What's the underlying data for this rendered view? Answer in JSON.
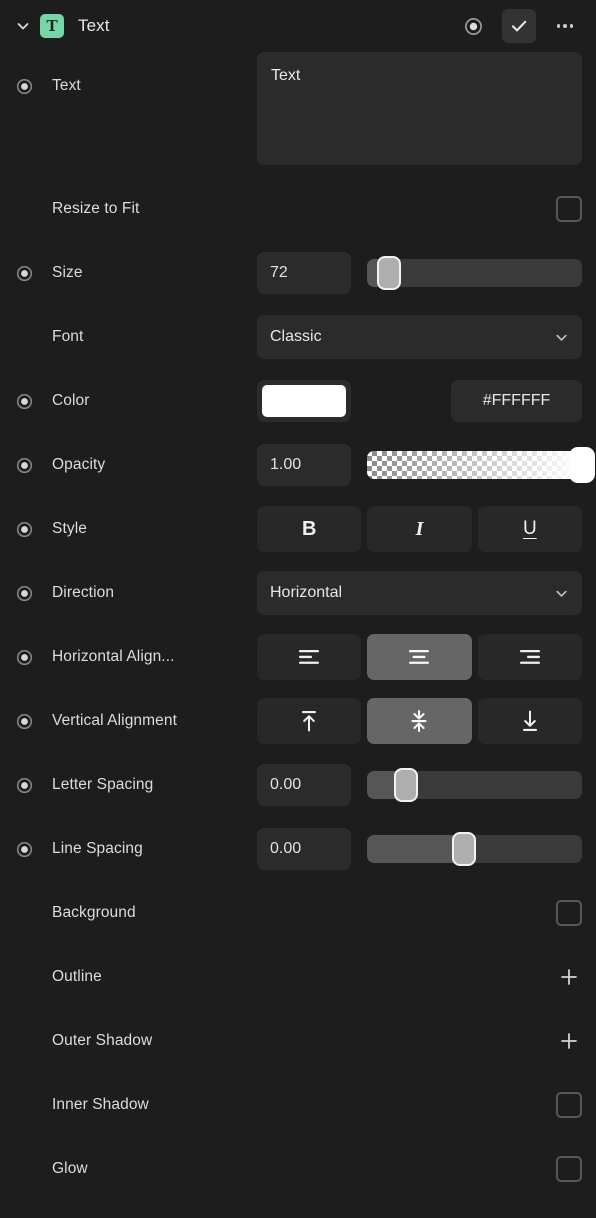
{
  "header": {
    "collapse_icon": "chevron-down-icon",
    "layer_icon_letter": "T",
    "title": "Text",
    "keyframe_icon": "record-icon",
    "confirm_icon": "check-icon",
    "more_icon": "more-dots-icon",
    "accent_color": "#77d6a8"
  },
  "rows": {
    "text": {
      "label": "Text",
      "value": "Text"
    },
    "resize_to_fit": {
      "label": "Resize to Fit",
      "checked": false
    },
    "size": {
      "label": "Size",
      "value": "72",
      "slider_percent": 10
    },
    "font": {
      "label": "Font",
      "value": "Classic"
    },
    "color": {
      "label": "Color",
      "swatch": "#FFFFFF",
      "hex": "#FFFFFF"
    },
    "opacity": {
      "label": "Opacity",
      "value": "1.00",
      "slider_percent": 100
    },
    "style": {
      "label": "Style",
      "options": [
        {
          "name": "bold",
          "glyph": "B",
          "selected": false
        },
        {
          "name": "italic",
          "glyph": "I",
          "selected": false
        },
        {
          "name": "underline",
          "glyph": "U",
          "selected": false
        }
      ]
    },
    "direction": {
      "label": "Direction",
      "value": "Horizontal"
    },
    "horizontal_alignment": {
      "label": "Horizontal Align...",
      "options": [
        {
          "name": "align-left-icon",
          "selected": false
        },
        {
          "name": "align-center-icon",
          "selected": true
        },
        {
          "name": "align-right-icon",
          "selected": false
        }
      ]
    },
    "vertical_alignment": {
      "label": "Vertical Alignment",
      "options": [
        {
          "name": "align-top-icon",
          "selected": false
        },
        {
          "name": "align-middle-icon",
          "selected": true
        },
        {
          "name": "align-bottom-icon",
          "selected": false
        }
      ]
    },
    "letter_spacing": {
      "label": "Letter Spacing",
      "value": "0.00",
      "slider_percent": 18
    },
    "line_spacing": {
      "label": "Line Spacing",
      "value": "0.00",
      "slider_percent": 45
    },
    "background": {
      "label": "Background",
      "checked": false
    },
    "outline": {
      "label": "Outline",
      "action": "plus-icon"
    },
    "outer_shadow": {
      "label": "Outer Shadow",
      "action": "plus-icon"
    },
    "inner_shadow": {
      "label": "Inner Shadow",
      "checked": false
    },
    "glow": {
      "label": "Glow",
      "checked": false
    }
  }
}
